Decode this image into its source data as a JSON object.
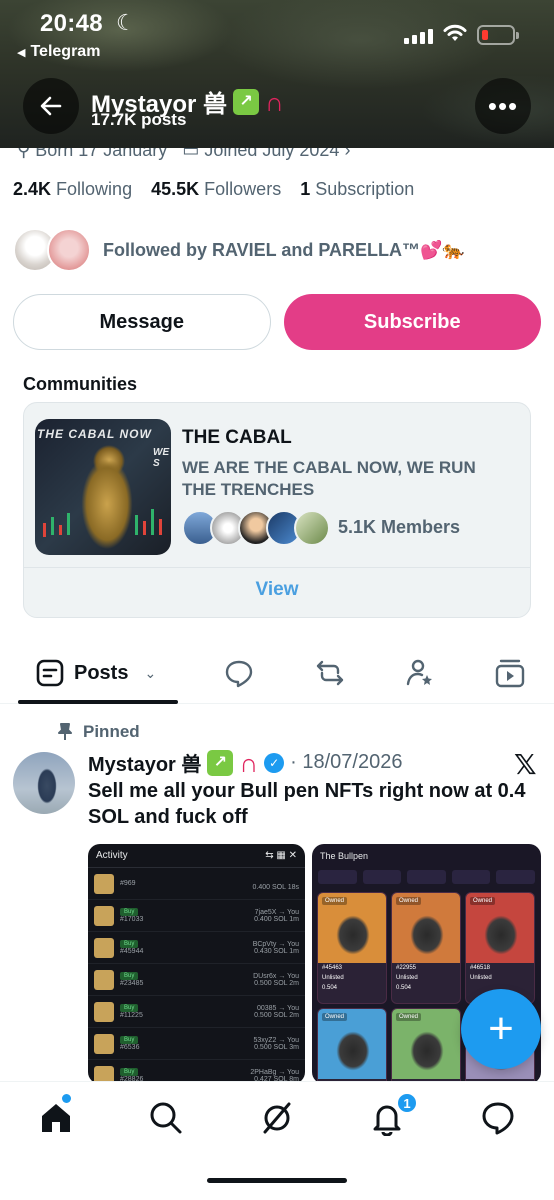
{
  "status_bar": {
    "time": "20:48",
    "back_app": "Telegram"
  },
  "header": {
    "name": "Mystayor 兽",
    "posts_count": "17.7K posts"
  },
  "profile": {
    "meta": {
      "born": "Born 17 January",
      "joined": "Joined July 2024"
    },
    "stats": {
      "following_count": "2.4K",
      "following_label": "Following",
      "followers_count": "45.5K",
      "followers_label": "Followers",
      "subscription_count": "1",
      "subscription_label": "Subscription"
    },
    "followed_by": "Followed by RAVIEL and PARELLA™💕🐅"
  },
  "buttons": {
    "message": "Message",
    "subscribe": "Subscribe"
  },
  "communities": {
    "title": "Communities",
    "card": {
      "image_caption": "THE CABAL NOW",
      "image_caption_2": "WE S",
      "name": "THE CABAL",
      "description": "WE ARE THE CABAL NOW, WE RUN THE TRENCHES",
      "members": "5.1K Members",
      "view": "View"
    }
  },
  "tabs": {
    "posts": "Posts"
  },
  "tweet": {
    "pinned": "Pinned",
    "author": "Mystayor 兽",
    "date": "· 18/07/2026",
    "text": "Sell me all your Bull pen NFTs right now at 0.4 SOL and fuck off",
    "media_left": {
      "title": "Activity",
      "rows": [
        {
          "id": "#969",
          "price": "0.400 SOL",
          "time": "18s",
          "buy": "",
          "user": ""
        },
        {
          "id": "#17033",
          "price": "0.400 SOL",
          "time": "1m",
          "buy": "Buy",
          "user": "7jae5X → You"
        },
        {
          "id": "#45944",
          "price": "0.430 SOL",
          "time": "1m",
          "buy": "Buy",
          "user": "BCpVty → You"
        },
        {
          "id": "#23485",
          "price": "0.500 SOL",
          "time": "2m",
          "buy": "Buy",
          "user": "DUsr6x → You"
        },
        {
          "id": "#11225",
          "price": "0.500 SOL",
          "time": "2m",
          "buy": "Buy",
          "user": "00385 → You"
        },
        {
          "id": "#6536",
          "price": "0.500 SOL",
          "time": "3m",
          "buy": "Buy",
          "user": "53xyZ2 → You"
        },
        {
          "id": "#28826",
          "price": "0.427 SOL",
          "time": "8m",
          "buy": "Buy",
          "user": "2PHaBg → You"
        }
      ]
    },
    "media_right": {
      "title": "The Bullpen",
      "items": [
        {
          "owned": "Owned",
          "id": "#45463",
          "status": "Unlisted",
          "price": "0.504",
          "color": "#d98e3a"
        },
        {
          "owned": "Owned",
          "id": "#22955",
          "status": "Unlisted",
          "price": "0.504",
          "color": "#d07a3c"
        },
        {
          "owned": "Owned",
          "id": "#46518",
          "status": "Unlisted",
          "price": "",
          "color": "#c5463e"
        },
        {
          "owned": "Owned",
          "id": "",
          "status": "",
          "price": "",
          "color": "#4a9fd6"
        },
        {
          "owned": "Owned",
          "id": "",
          "status": "",
          "price": "",
          "color": "#7bb36a"
        },
        {
          "owned": "",
          "id": "",
          "status": "",
          "price": "",
          "color": "#9a8fb8"
        }
      ]
    }
  },
  "nav": {
    "notifications_badge": "1"
  },
  "colors": {
    "accent": "#1d9bf0",
    "subscribe": "#e33d87",
    "muted": "#536471"
  }
}
